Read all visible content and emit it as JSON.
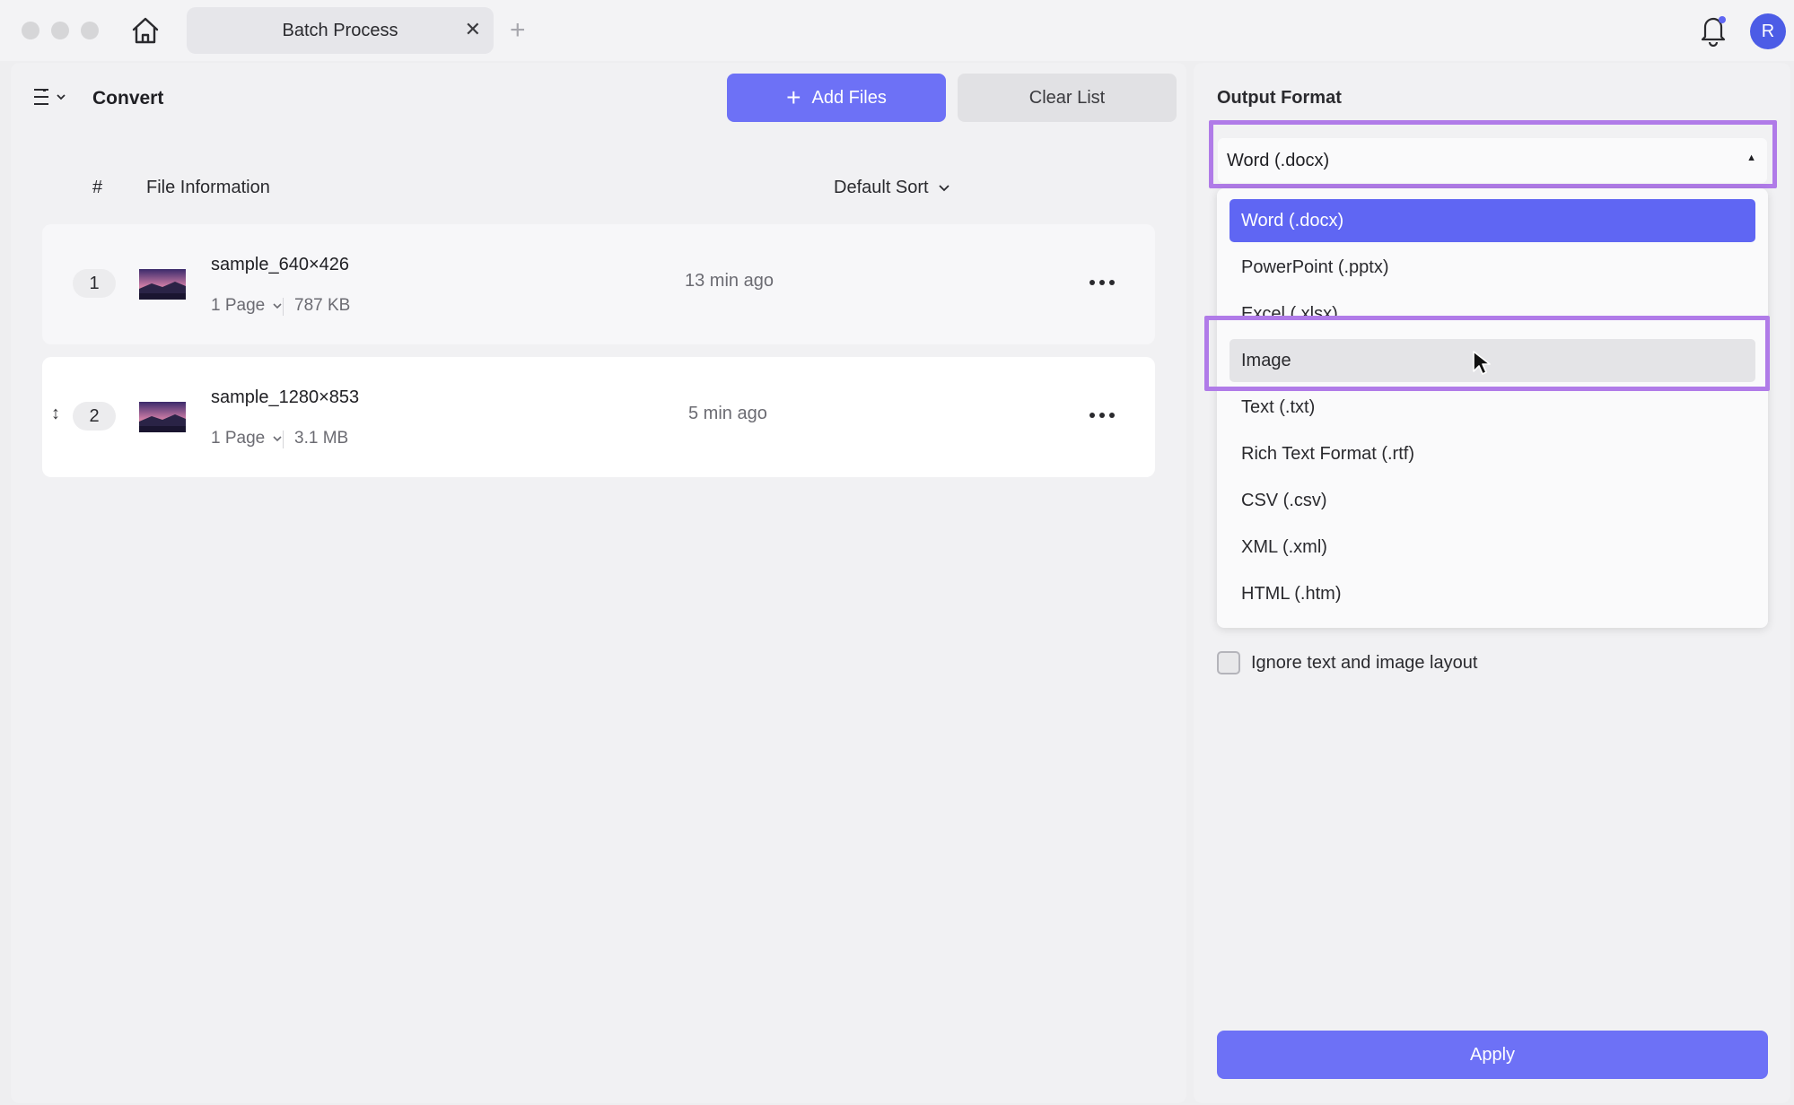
{
  "tab": {
    "title": "Batch Process",
    "close": "✕",
    "add": "+"
  },
  "user": {
    "avatar_initial": "R"
  },
  "left": {
    "title": "Convert",
    "add_files_label": "Add Files",
    "add_files_icon": "+",
    "clear_list_label": "Clear List",
    "columns": {
      "number": "#",
      "info": "File Information"
    },
    "sort_label": "Default Sort",
    "files": [
      {
        "number": "1",
        "name": "sample_640×426",
        "pages": "1 Page",
        "size": "787 KB",
        "time": "13 min ago"
      },
      {
        "number": "2",
        "name": "sample_1280×853",
        "pages": "1 Page",
        "size": "3.1 MB",
        "time": "5 min ago"
      }
    ],
    "drag_handle": "↕"
  },
  "right": {
    "output_label": "Output Format",
    "selected_format": "Word (.docx)",
    "caret": "▲",
    "options": [
      "Word (.docx)",
      "PowerPoint (.pptx)",
      "Excel (.xlsx)",
      "Image",
      "Text (.txt)",
      "Rich Text Format (.rtf)",
      "CSV (.csv)",
      "XML (.xml)",
      "HTML (.htm)"
    ],
    "hovered_option": "Image",
    "checkbox_label": "Ignore text and image layout",
    "apply_label": "Apply"
  },
  "colors": {
    "accent": "#6d71f6",
    "selected": "#5f66f3",
    "highlight": "#b07be8",
    "avatar": "#4c5ce6"
  }
}
